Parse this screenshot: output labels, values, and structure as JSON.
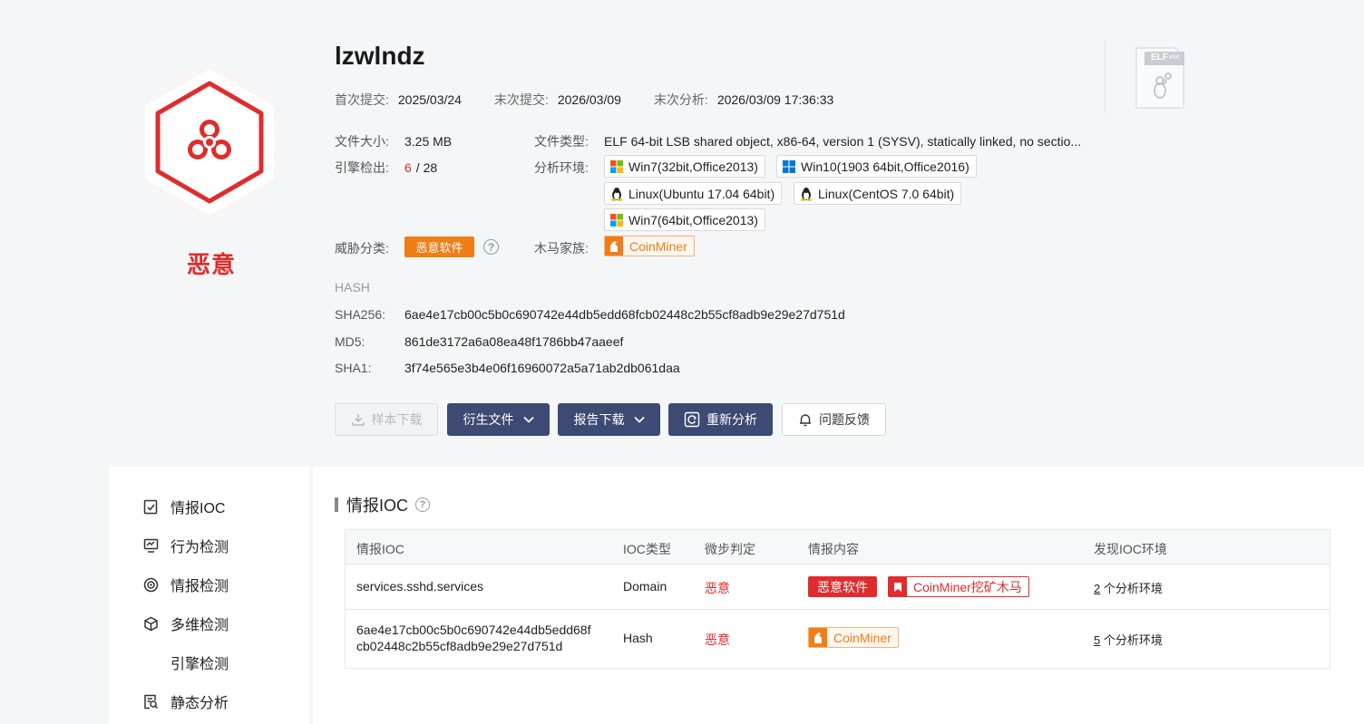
{
  "sample": {
    "name": "lzwlndz",
    "verdict": "恶意",
    "first_submit_label": "首次提交:",
    "first_submit": "2025/03/24",
    "last_submit_label": "末次提交:",
    "last_submit": "2026/03/09",
    "last_analysis_label": "末次分析:",
    "last_analysis": "2026/03/09 17:36:33",
    "file_size_label": "文件大小:",
    "file_size": "3.25 MB",
    "file_type_label": "文件类型:",
    "file_type": "ELF 64-bit LSB shared object, x86-64, version 1 (SYSV), statically linked, no sectio...",
    "engine_label": "引擎检出:",
    "engine_hits": "6",
    "engine_total": "/ 28",
    "env_label": "分析环境:",
    "environments": [
      "Win7(32bit,Office2013)",
      "Win10(1903 64bit,Office2016)",
      "Linux(Ubuntu 17.04 64bit)",
      "Linux(CentOS 7.0 64bit)",
      "Win7(64bit,Office2013)"
    ],
    "threat_label": "威胁分类:",
    "threat_class": "恶意软件",
    "family_label": "木马家族:",
    "family": "CoinMiner",
    "file_icon_text": "ELF",
    "file_icon_sub": "x64"
  },
  "hash": {
    "title": "HASH",
    "sha256_label": "SHA256:",
    "sha256": "6ae4e17cb00c5b0c690742e44db5edd68fcb02448c2b55cf8adb9e29e27d751d",
    "md5_label": "MD5:",
    "md5": "861de3172a6a08ea48f1786bb47aaeef",
    "sha1_label": "SHA1:",
    "sha1": "3f74e565e3b4e06f16960072a5a71ab2db061daa"
  },
  "actions": {
    "download_sample": "样本下载",
    "derived_files": "衍生文件",
    "report_download": "报告下载",
    "reanalyze": "重新分析",
    "feedback": "问题反馈"
  },
  "nav": {
    "items": [
      "情报IOC",
      "行为检测",
      "情报检测",
      "多维检测",
      "引擎检测",
      "静态分析"
    ]
  },
  "ioc": {
    "title": "情报IOC",
    "headers": [
      "情报IOC",
      "IOC类型",
      "微步判定",
      "情报内容",
      "发现IOC环境"
    ],
    "rows": [
      {
        "ioc": "services.sshd.services",
        "type": "Domain",
        "verdict": "恶意",
        "tag1": "恶意软件",
        "tag2": "CoinMiner挖矿木马",
        "env_count": "2",
        "env_suffix": "个分析环境"
      },
      {
        "ioc_line1": "6ae4e17cb00c5b0c690742e44db5edd68f",
        "ioc_line2": "cb02448c2b55cf8adb9e29e27d751d",
        "type": "Hash",
        "verdict": "恶意",
        "tag1": "CoinMiner",
        "env_count": "5",
        "env_suffix": "个分析环境"
      }
    ]
  },
  "colors": {
    "malicious": "#e02c2c",
    "orange": "#f07d16",
    "button_dark": "#3d4a73"
  }
}
